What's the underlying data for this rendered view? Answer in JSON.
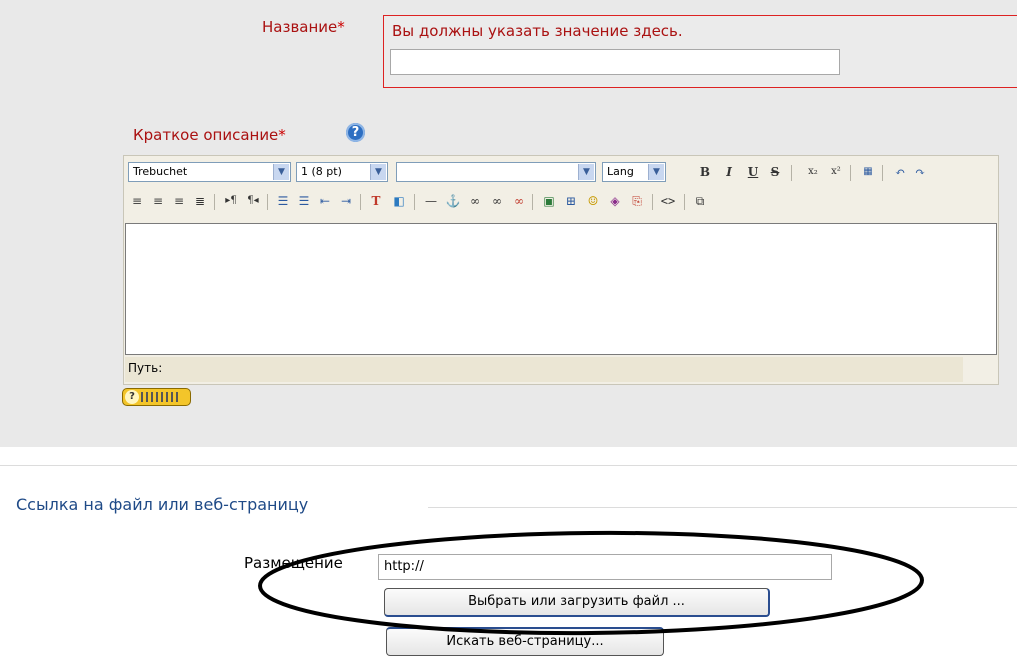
{
  "form": {
    "name_label": "Название",
    "required_mark": "*",
    "name_error": "Вы должны указать значение здесь.",
    "summary_label": "Краткое описание",
    "help_icon_glyph": "?"
  },
  "editor": {
    "font_select": "Trebuchet",
    "size_select": "1 (8 pt)",
    "format_select": "",
    "lang_select": "Lang",
    "path_label": "Путь:",
    "row1_icons": [
      "bold-icon",
      "italic-icon",
      "underline-icon",
      "strikethrough-icon",
      "subscript-icon",
      "superscript-icon",
      "paste-word-icon",
      "undo-icon",
      "redo-icon"
    ],
    "row2_icons": [
      "align-left-icon",
      "align-center-icon",
      "align-right-icon",
      "justify-icon",
      "ltr-icon",
      "rtl-icon",
      "ordered-list-icon",
      "unordered-list-icon",
      "outdent-icon",
      "indent-icon",
      "text-color-icon",
      "background-color-icon",
      "horizontal-rule-icon",
      "anchor-icon",
      "link-icon",
      "unlink-icon",
      "nolink-icon",
      "image-icon",
      "table-icon",
      "smiley-icon",
      "special-char-icon",
      "search-replace-icon",
      "html-source-icon",
      "fullscreen-icon"
    ]
  },
  "link_section": {
    "legend": "Ссылка на файл или веб-страницу",
    "location_label": "Размещение",
    "location_value": "http://",
    "choose_button": "Выбрать или загрузить файл ...",
    "search_button": "Искать веб-страницу..."
  },
  "colors": {
    "panel_bg": "#e9e9e9",
    "error_red": "#aa1111",
    "legend_blue": "#1f4a87"
  }
}
